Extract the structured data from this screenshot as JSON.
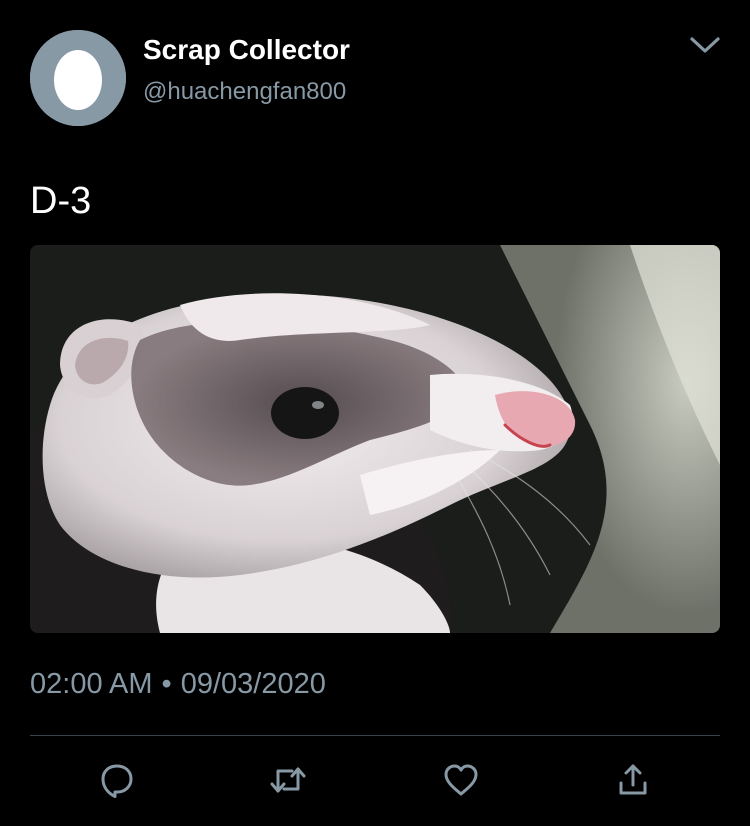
{
  "tweet": {
    "author": {
      "display_name": "Scrap Collector",
      "handle": "@huachengfan800",
      "avatar_icon": "default-egg-avatar-icon"
    },
    "text": "D-3",
    "media": {
      "kind": "photo"
    },
    "time": "02:00 AM",
    "separator": "•",
    "date": "09/03/2020",
    "actions": [
      {
        "icon": "reply-icon"
      },
      {
        "icon": "retweet-icon"
      },
      {
        "icon": "like-icon"
      },
      {
        "icon": "share-icon"
      }
    ],
    "menu_icon": "chevron-down-icon"
  },
  "colors": {
    "background": "#000000",
    "primary_text": "#ffffff",
    "secondary_text": "#8899a6",
    "divider": "#38444d",
    "icon": "#8899a6"
  }
}
